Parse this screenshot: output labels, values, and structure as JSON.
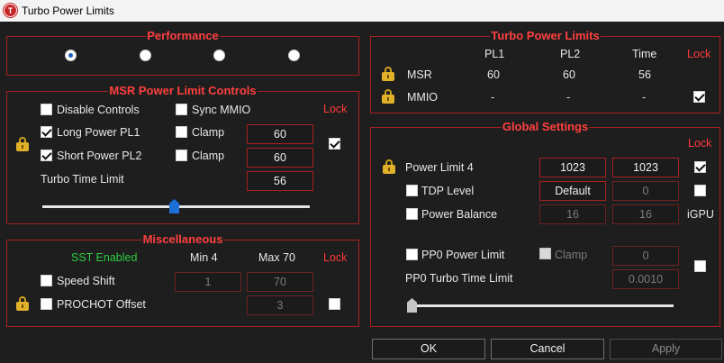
{
  "window": {
    "title": "Turbo Power Limits",
    "icon": "T"
  },
  "performance": {
    "title": "Performance",
    "selected_index": 0,
    "radio_count": 4
  },
  "msr": {
    "title": "MSR Power Limit Controls",
    "lock_label": "Lock",
    "disable_controls": {
      "label": "Disable Controls",
      "checked": false
    },
    "sync_mmio": {
      "label": "Sync MMIO",
      "checked": false
    },
    "long_power": {
      "label": "Long Power PL1",
      "checked": true,
      "clamp_label": "Clamp",
      "clamp_checked": false,
      "value": "60"
    },
    "short_power": {
      "label": "Short Power PL2",
      "checked": true,
      "clamp_label": "Clamp",
      "clamp_checked": false,
      "value": "60"
    },
    "turbo_time": {
      "label": "Turbo Time Limit",
      "value": "56"
    },
    "lock_checked": true,
    "slider_fraction": 0.55
  },
  "misc": {
    "title": "Miscellaneous",
    "sst_status": "SST Enabled",
    "min_label": "Min  4",
    "max_label": "Max  70",
    "lock_label": "Lock",
    "speed_shift": {
      "label": "Speed Shift",
      "checked": false,
      "min": "1",
      "max": "70"
    },
    "prochot": {
      "label": "PROCHOT Offset",
      "checked": false,
      "value": "3",
      "lock_checked": false
    }
  },
  "turbo": {
    "title": "Turbo Power Limits",
    "headers": {
      "pl1": "PL1",
      "pl2": "PL2",
      "time": "Time",
      "lock": "Lock"
    },
    "rows": [
      {
        "name": "MSR",
        "pl1": "60",
        "pl2": "60",
        "time": "56"
      },
      {
        "name": "MMIO",
        "pl1": "-",
        "pl2": "-",
        "time": "-",
        "lock_checked": true
      }
    ]
  },
  "global": {
    "title": "Global Settings",
    "lock_label": "Lock",
    "power_limit4": {
      "label": "Power Limit 4",
      "value1": "1023",
      "value2": "1023",
      "lock_checked": true
    },
    "tdp_level": {
      "label": "TDP Level",
      "checked": false,
      "value1": "Default",
      "value2": "0",
      "right_checked": false
    },
    "power_balance": {
      "label": "Power Balance",
      "checked": false,
      "value1": "16",
      "value2": "16",
      "igpu_label": "iGPU"
    },
    "pp0_power_limit": {
      "label": "PP0 Power Limit",
      "checked": false,
      "clamp_label": "Clamp",
      "clamp_checked": false,
      "value": "0",
      "right_checked": false
    },
    "pp0_turbo_time": {
      "label": "PP0 Turbo Time Limit",
      "value": "0.0010"
    },
    "slider_fraction": 0.0
  },
  "buttons": {
    "ok": "OK",
    "cancel": "Cancel",
    "apply": "Apply"
  },
  "colors": {
    "accent_red": "#ff3b3b",
    "border_red": "#a62020",
    "lock_gold": "#e1b12a",
    "sst_green": "#2ecc40",
    "slider_blue": "#1c6fd6"
  }
}
